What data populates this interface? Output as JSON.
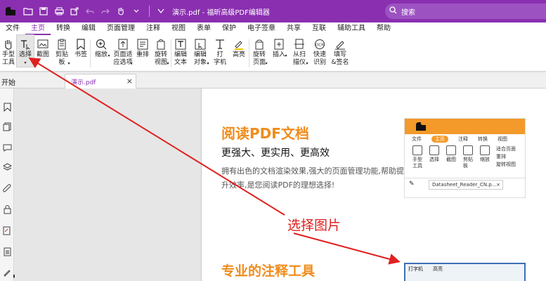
{
  "titlebar": {
    "title": "演示.pdf - 福昕高级PDF编辑器",
    "search_placeholder": "搜索",
    "bg_color": "#8a2fb0"
  },
  "menu": {
    "items": [
      "文件",
      "主页",
      "转换",
      "编辑",
      "页面管理",
      "注释",
      "视图",
      "表单",
      "保护",
      "电子签章",
      "共享",
      "互联",
      "辅助工具",
      "帮助"
    ],
    "active": "主页"
  },
  "ribbon": {
    "buttons": [
      {
        "label": "手型\n工具",
        "icon": "hand-icon"
      },
      {
        "label": "选择",
        "icon": "select-text-icon",
        "caret": true
      },
      {
        "label": "截图",
        "icon": "screenshot-icon"
      },
      {
        "label": "剪贴\n板",
        "icon": "clipboard-icon",
        "caret": true
      },
      {
        "label": "书签",
        "icon": "bookmark-icon"
      },
      {
        "label": "缩放",
        "icon": "zoom-icon",
        "caret": true
      },
      {
        "label": "页面适\n应选项",
        "icon": "fit-page-icon",
        "caret": true
      },
      {
        "label": "重排",
        "icon": "reflow-icon"
      },
      {
        "label": "旋转\n视图",
        "icon": "rotate-view-icon",
        "caret": true
      },
      {
        "label": "编辑\n文本",
        "icon": "edit-text-icon"
      },
      {
        "label": "编辑\n对象",
        "icon": "edit-object-icon",
        "caret": true
      },
      {
        "label": "打\n字机",
        "icon": "typewriter-icon"
      },
      {
        "label": "高亮",
        "icon": "highlight-icon"
      },
      {
        "label": "旋转\n页面",
        "icon": "rotate-page-icon",
        "caret": true
      },
      {
        "label": "插入",
        "icon": "insert-icon",
        "caret": true
      },
      {
        "label": "从扫\n描仪",
        "icon": "scanner-icon",
        "caret": true
      },
      {
        "label": "快速\n识别",
        "icon": "ocr-icon"
      },
      {
        "label": "填写\n&签名",
        "icon": "sign-icon"
      }
    ]
  },
  "tabs": {
    "start_label": "开始",
    "doc_tab_name": "演示.pdf",
    "close_glyph": "×"
  },
  "document": {
    "heading1": "阅读PDF文档",
    "heading2": "更强大、更实用、更高效",
    "paragraph": "拥有出色的文档渲染效果,强大的页面管理功能,帮助提升效率,是您阅读PDF的理想选择!",
    "heading3": "专业的注释工具",
    "annotation": "选择图片"
  },
  "mini_screenshot": {
    "tabs": [
      "文件",
      "主页",
      "注释",
      "转换",
      "视图"
    ],
    "active_tab": "主页",
    "buttons": [
      "手型\n工具",
      "选择",
      "截图",
      "剪贴\n板",
      "缩放"
    ],
    "right_items": [
      "适合页面",
      "重排",
      "旋转视图"
    ],
    "doc_tab": "Datasheet_Reader_CN.p...",
    "close_glyph": "×"
  },
  "mini_screenshot2": {
    "items": [
      "打字机",
      "高亮"
    ]
  },
  "colors": {
    "accent": "#8a2fb0",
    "heading_orange": "#f08c1c",
    "annotation_red": "#e02020"
  }
}
